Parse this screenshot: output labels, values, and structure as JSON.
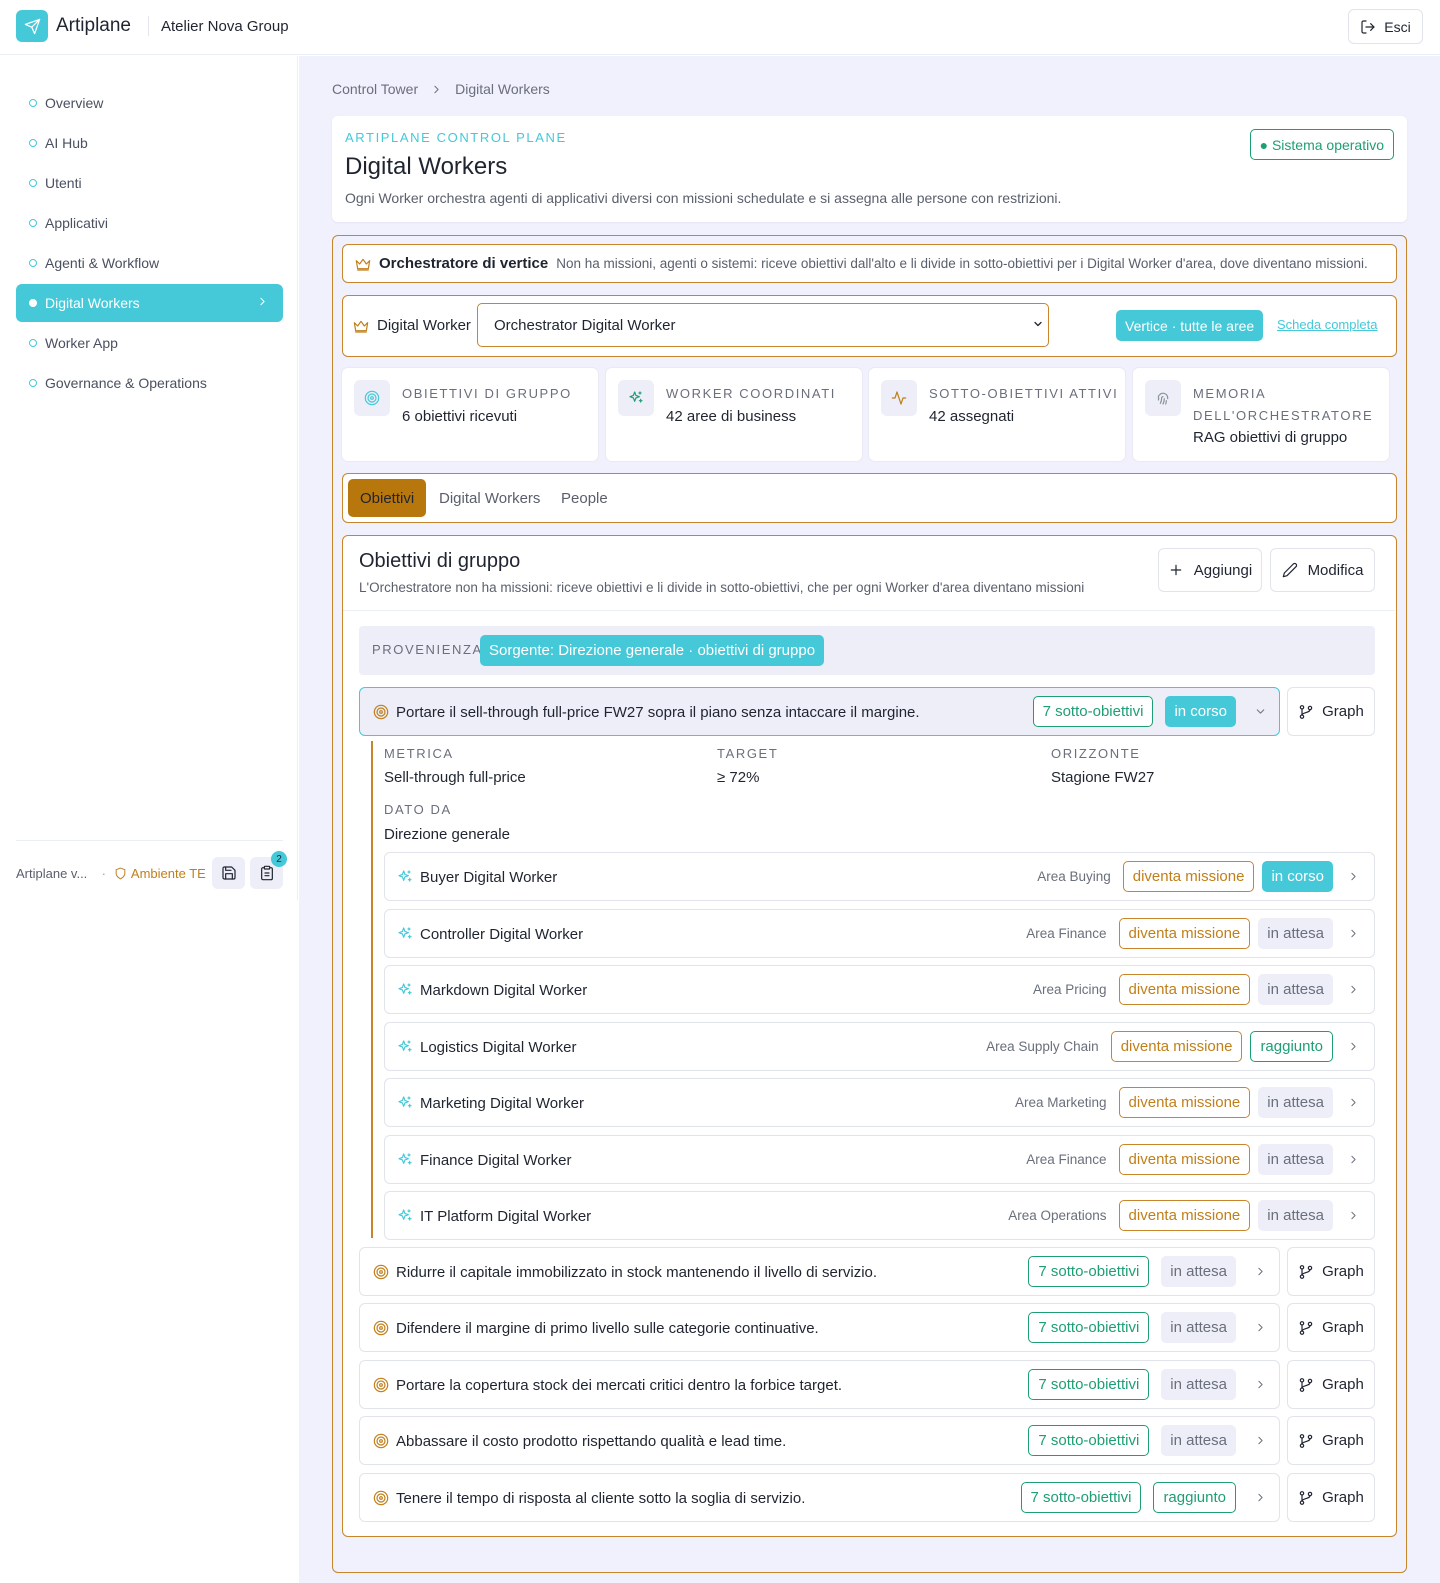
{
  "app": {
    "name": "Artiplane",
    "org": "Atelier Nova Group",
    "logout_label": "Esci"
  },
  "colors": {
    "accent": "#45c8d8",
    "orange": "#c7852c",
    "green": "#1e9e75",
    "main_bg": "#f1f0fd"
  },
  "sidebar": {
    "items": [
      {
        "label": "Overview"
      },
      {
        "label": "AI Hub"
      },
      {
        "label": "Utenti"
      },
      {
        "label": "Applicativi"
      },
      {
        "label": "Agenti & Workflow"
      },
      {
        "label": "Digital Workers",
        "active": true
      },
      {
        "label": "Worker App"
      },
      {
        "label": "Governance & Operations"
      }
    ],
    "footer": {
      "version": "Artiplane v...",
      "env": "Ambiente TE",
      "badge_count": "2"
    }
  },
  "breadcrumb": {
    "root": "Control Tower",
    "current": "Digital Workers"
  },
  "header": {
    "kicker": "ARTIPLANE CONTROL PLANE",
    "title": "Digital Workers",
    "subtitle": "Ogni Worker orchestra agenti di applicativi diversi con missioni schedulate e si assegna alle persone con restrizioni.",
    "status": "● Sistema operativo"
  },
  "orchestrator": {
    "title": "Orchestratore di vertice",
    "description": "Non ha missioni, agenti o sistemi: riceve obiettivi dall'alto e li divide in sotto-obiettivi per i Digital Worker d'area, dove diventano missioni."
  },
  "worker_select": {
    "label": "Digital Worker",
    "value": "Orchestrator Digital Worker",
    "scope": "Vertice · tutte le aree",
    "link": "Scheda completa"
  },
  "stats": [
    {
      "label": "OBIETTIVI DI GRUPPO",
      "value": "6 obiettivi ricevuti",
      "icon": "target-icon"
    },
    {
      "label": "WORKER COORDINATI",
      "value": "42 aree di business",
      "icon": "sparkles-icon"
    },
    {
      "label": "SOTTO-OBIETTIVI ATTIVI",
      "value": "42 assegnati",
      "icon": "activity-icon"
    },
    {
      "label": "MEMORIA DELL'ORCHESTRATORE",
      "value": "RAG obiettivi di gruppo",
      "icon": "fingerprint-icon"
    }
  ],
  "tabs": [
    {
      "label": "Obiettivi",
      "active": true
    },
    {
      "label": "Digital Workers"
    },
    {
      "label": "People"
    }
  ],
  "panel": {
    "title": "Obiettivi di gruppo",
    "subtitle": "L'Orchestratore non ha missioni: riceve obiettivi e li divide in sotto-obiettivi, che per ogni Worker d'area diventano missioni",
    "add_label": "Aggiungi",
    "edit_label": "Modifica",
    "provenance_label": "PROVENIENZA",
    "provenance_value": "Sorgente: Direzione generale · obiettivi di gruppo",
    "graph_label": "Graph"
  },
  "goals": [
    {
      "title": "Portare il sell-through full-price FW27 sopra il piano senza intaccare il margine.",
      "count": "7 sotto-obiettivi",
      "status": "in corso",
      "status_kind": "cyan",
      "open": true
    },
    {
      "title": "Ridurre il capitale immobilizzato in stock mantenendo il livello di servizio.",
      "count": "7 sotto-obiettivi",
      "status": "in attesa",
      "status_kind": "gray"
    },
    {
      "title": "Difendere il margine di primo livello sulle categorie continuative.",
      "count": "7 sotto-obiettivi",
      "status": "in attesa",
      "status_kind": "gray"
    },
    {
      "title": "Portare la copertura stock dei mercati critici dentro la forbice target.",
      "count": "7 sotto-obiettivi",
      "status": "in attesa",
      "status_kind": "gray"
    },
    {
      "title": "Abbassare il costo prodotto rispettando qualità e lead time.",
      "count": "7 sotto-obiettivi",
      "status": "in attesa",
      "status_kind": "gray"
    },
    {
      "title": "Tenere il tempo di risposta al cliente sotto la soglia di servizio.",
      "count": "7 sotto-obiettivi",
      "status": "raggiunto",
      "status_kind": "green"
    }
  ],
  "goal_detail": {
    "metric_label": "METRICA",
    "metric": "Sell-through full-price",
    "target_label": "TARGET",
    "target": "≥ 72%",
    "horizon_label": "ORIZZONTE",
    "horizon": "Stagione FW27",
    "given_label": "DATO DA",
    "given": "Direzione generale",
    "mission_label": "diventa missione"
  },
  "subgoals": [
    {
      "worker": "Buyer Digital Worker",
      "area": "Area Buying",
      "status": "in corso",
      "status_kind": "cyan"
    },
    {
      "worker": "Controller Digital Worker",
      "area": "Area Finance",
      "status": "in attesa",
      "status_kind": "gray"
    },
    {
      "worker": "Markdown Digital Worker",
      "area": "Area Pricing",
      "status": "in attesa",
      "status_kind": "gray"
    },
    {
      "worker": "Logistics Digital Worker",
      "area": "Area Supply Chain",
      "status": "raggiunto",
      "status_kind": "green"
    },
    {
      "worker": "Marketing Digital Worker",
      "area": "Area Marketing",
      "status": "in attesa",
      "status_kind": "gray"
    },
    {
      "worker": "Finance Digital Worker",
      "area": "Area Finance",
      "status": "in attesa",
      "status_kind": "gray"
    },
    {
      "worker": "IT Platform Digital Worker",
      "area": "Area Operations",
      "status": "in attesa",
      "status_kind": "gray"
    }
  ]
}
